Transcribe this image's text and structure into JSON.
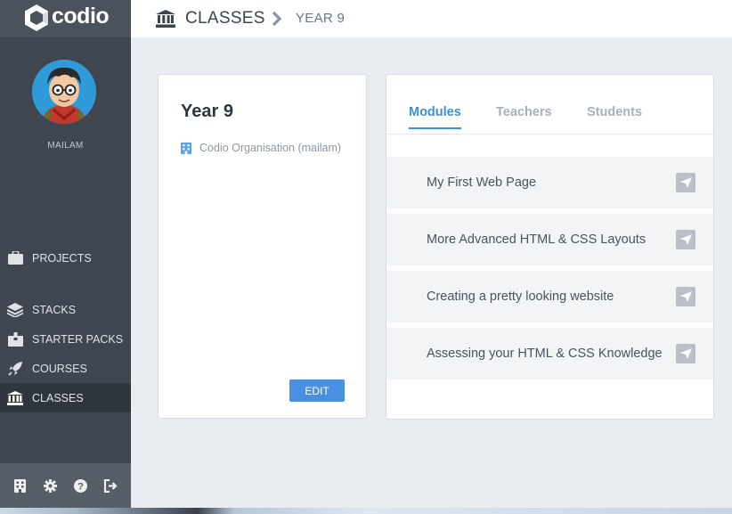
{
  "app": {
    "logo_text": "codio"
  },
  "user": {
    "name": "MAILAM"
  },
  "sidebar": {
    "items": [
      {
        "label": "PROJECTS",
        "icon": "briefcase-icon"
      },
      {
        "label": "STACKS",
        "icon": "layers-icon"
      },
      {
        "label": "STARTER PACKS",
        "icon": "box-icon"
      },
      {
        "label": "COURSES",
        "icon": "rocket-icon"
      },
      {
        "label": "CLASSES",
        "icon": "bank-icon",
        "active": true
      }
    ],
    "footer_icons": [
      "building-icon",
      "gear-icon",
      "help-icon",
      "logout-icon"
    ]
  },
  "breadcrumb": {
    "section": "CLASSES",
    "current": "YEAR 9"
  },
  "class_card": {
    "title": "Year 9",
    "organisation": "Codio Organisation (mailam)",
    "edit_label": "EDIT"
  },
  "panel": {
    "tabs": [
      {
        "label": "Modules",
        "active": true
      },
      {
        "label": "Teachers"
      },
      {
        "label": "Students"
      }
    ],
    "modules": [
      {
        "label": "My First Web Page"
      },
      {
        "label": "More Advanced HTML & CSS Layouts"
      },
      {
        "label": "Creating a pretty looking website"
      },
      {
        "label": "Assessing your HTML & CSS Knowledge"
      }
    ]
  },
  "colors": {
    "accent": "#3d8fd6",
    "button": "#4a8fe0",
    "sidebar": "#3f4650",
    "background": "#e9ecf0"
  }
}
